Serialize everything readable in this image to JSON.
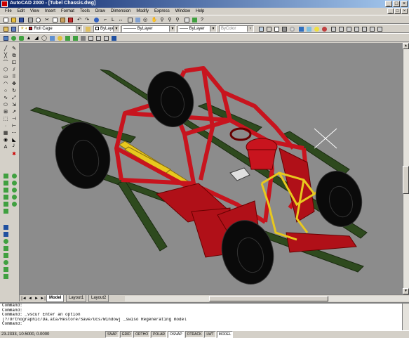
{
  "window": {
    "title": "AutoCAD 2000 - [Tubel Chassis.dwg]",
    "controls": [
      "_",
      "□",
      "×"
    ],
    "document_controls": [
      "_",
      "□",
      "×"
    ]
  },
  "menu": [
    "File",
    "Edit",
    "View",
    "Insert",
    "Format",
    "Tools",
    "Draw",
    "Dimension",
    "Modify",
    "Express",
    "Window",
    "Help"
  ],
  "toolbar": {
    "layer_value": "Roll Cage",
    "color_value": "ByLayer",
    "linetype_value": "ByLayer",
    "lineweight_value": "ByLayer",
    "plotstyle_value": "ByColor"
  },
  "viewport": {
    "background": "#8c8c8c",
    "model_colors": {
      "cage": "#c8141e",
      "frame": "#2e4a1e",
      "tire": "#0a0a0a",
      "yellow": "#e8c81e"
    }
  },
  "layout_tabs": {
    "nav": [
      "|◄",
      "◄",
      "►",
      "►|"
    ],
    "tabs": [
      {
        "label": "Model",
        "active": true
      },
      {
        "label": "Layout1",
        "active": false
      },
      {
        "label": "Layout2",
        "active": false
      }
    ]
  },
  "command": {
    "lines": [
      "Command:",
      "Command:",
      "Command: _vscur Enter an option",
      "[?/Orthographic/Da.ata/Restore/Save/Ucs/Window] _swiso Regenerating model",
      "Command:"
    ]
  },
  "statusbar": {
    "coordinates": "23.2333, 10.5000, 0.0000",
    "buttons": [
      {
        "label": "SNAP",
        "on": false
      },
      {
        "label": "GRID",
        "on": false
      },
      {
        "label": "ORTHO",
        "on": false
      },
      {
        "label": "POLAR",
        "on": false
      },
      {
        "label": "OSNAP",
        "on": true
      },
      {
        "label": "OTRACK",
        "on": false
      },
      {
        "label": "LWT",
        "on": false
      },
      {
        "label": "MODEL",
        "on": true
      }
    ]
  }
}
